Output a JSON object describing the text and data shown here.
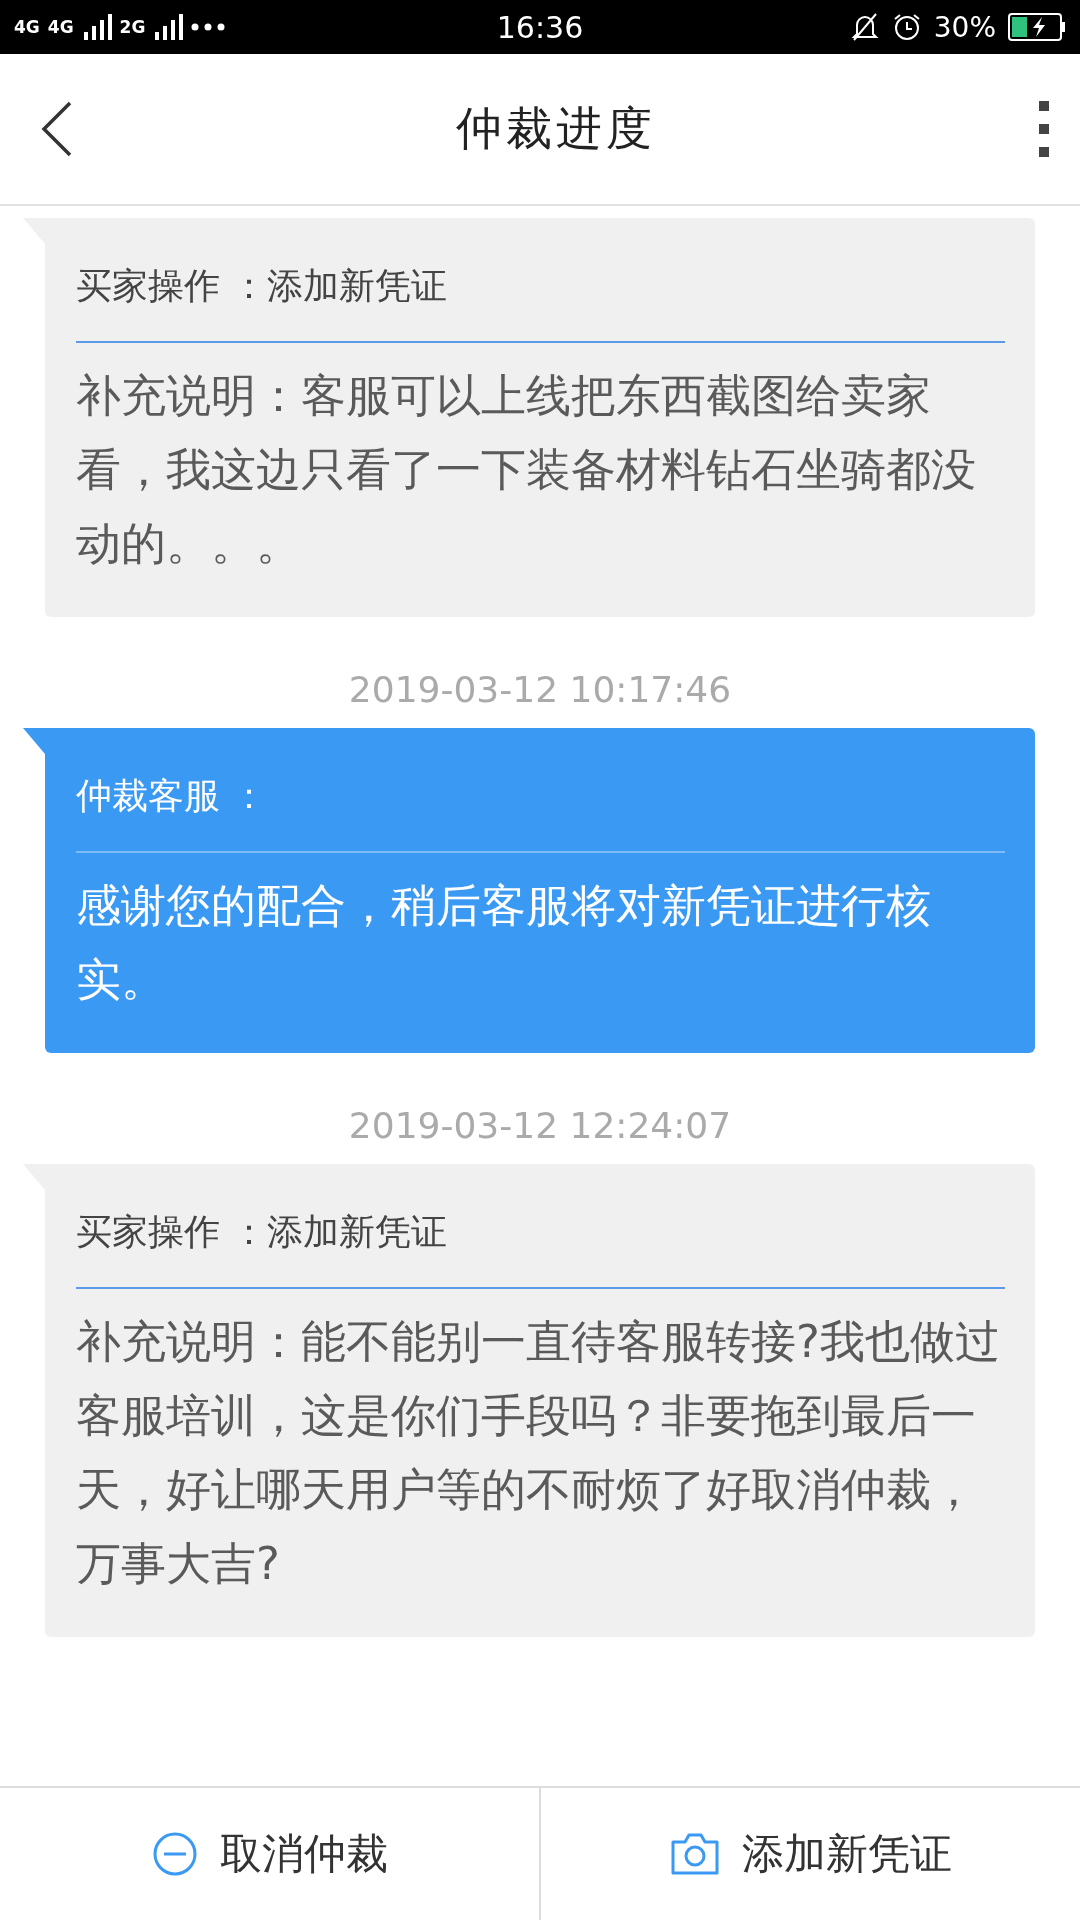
{
  "status_bar": {
    "network_1": "4G",
    "network_2": "4G",
    "network_3": "2G",
    "time": "16:36",
    "battery": "30%"
  },
  "header": {
    "title": "仲裁进度"
  },
  "messages": [
    {
      "kind": "buyer",
      "title": "买家操作 ：添加新凭证",
      "body": "补充说明：客服可以上线把东西截图给卖家看，我这边只看了一下装备材料钻石坐骑都没动的。。。"
    },
    {
      "kind": "agent",
      "time": "2019-03-12 10:17:46",
      "title": "仲裁客服 ：",
      "body": "感谢您的配合，稍后客服将对新凭证进行核实。"
    },
    {
      "kind": "buyer",
      "time": "2019-03-12 12:24:07",
      "title": "买家操作 ：添加新凭证",
      "body": "补充说明：能不能别一直待客服转接?我也做过客服培训，这是你们手段吗？非要拖到最后一天，好让哪天用户等的不耐烦了好取消仲裁，万事大吉?"
    }
  ],
  "actions": [
    {
      "kind": "cancel",
      "label": "取消仲裁"
    },
    {
      "kind": "camera",
      "label": "添加新凭证"
    }
  ]
}
